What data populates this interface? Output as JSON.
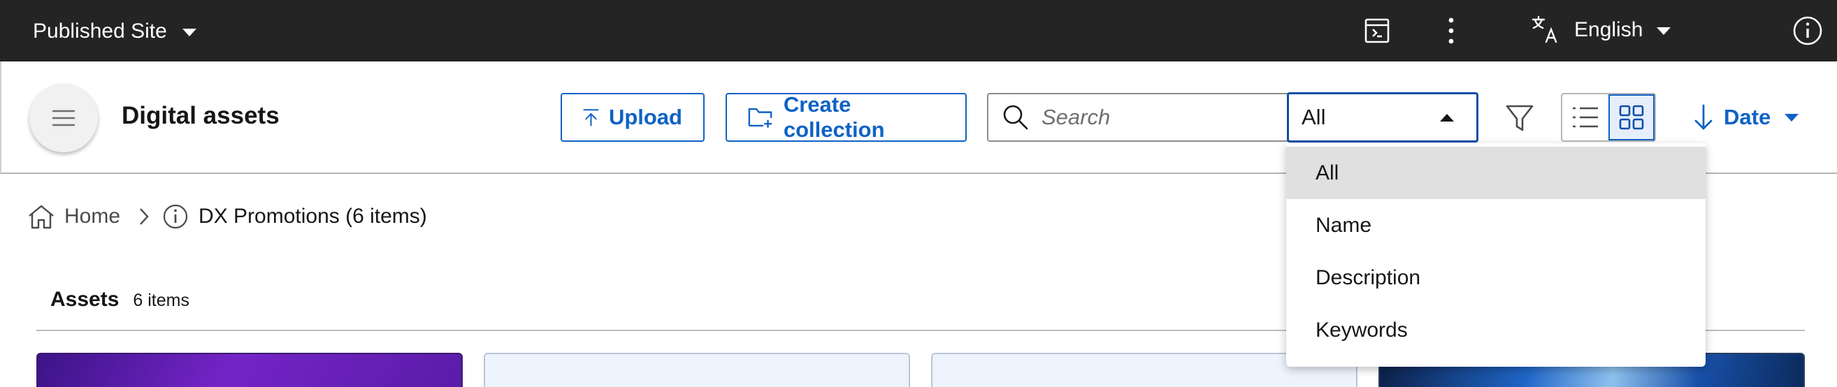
{
  "topbar": {
    "site_label": "Published Site",
    "language": "English",
    "icons": [
      "preview-icon",
      "kebab-menu-icon",
      "translate-icon",
      "info-icon"
    ]
  },
  "toolbar": {
    "title": "Digital assets",
    "upload_label": "Upload",
    "create_collection_label": "Create collection",
    "search_placeholder": "Search",
    "search_value": "",
    "search_scope_selected": "All",
    "sort_label": "Date",
    "active_view": "grid"
  },
  "breadcrumb": {
    "home": "Home",
    "current": "DX Promotions (6 items)"
  },
  "assets": {
    "title": "Assets",
    "count": "6 items"
  },
  "search_scope_dropdown": {
    "options": [
      "All",
      "Name",
      "Description",
      "Keywords"
    ],
    "highlighted": "All"
  },
  "colors": {
    "topbar_bg": "#242424",
    "accent": "#0f62c4",
    "select_border": "#0f4fa8",
    "dropdown_highlight": "#e0e0e0"
  }
}
